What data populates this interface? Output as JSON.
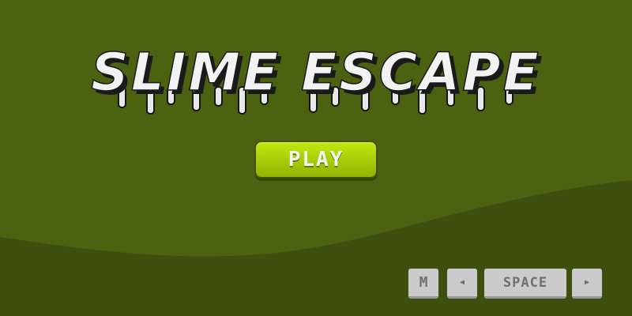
{
  "game": {
    "title": "SLIME ESCAPE",
    "play_label": "PLAY"
  },
  "controls": {
    "mute_key": "M",
    "left_key_icon": "◀",
    "space_key": "SPACE",
    "right_key_icon": "▶"
  },
  "colors": {
    "background": "#4b6210",
    "hill": "#3d5010",
    "play_button": "#a5cc08",
    "title_fill": "#f2f2f2",
    "title_shadow": "#1a1a1a",
    "key_fill": "#cbcbcb"
  },
  "icons": {
    "left": "arrow-left-icon",
    "right": "arrow-right-icon"
  }
}
